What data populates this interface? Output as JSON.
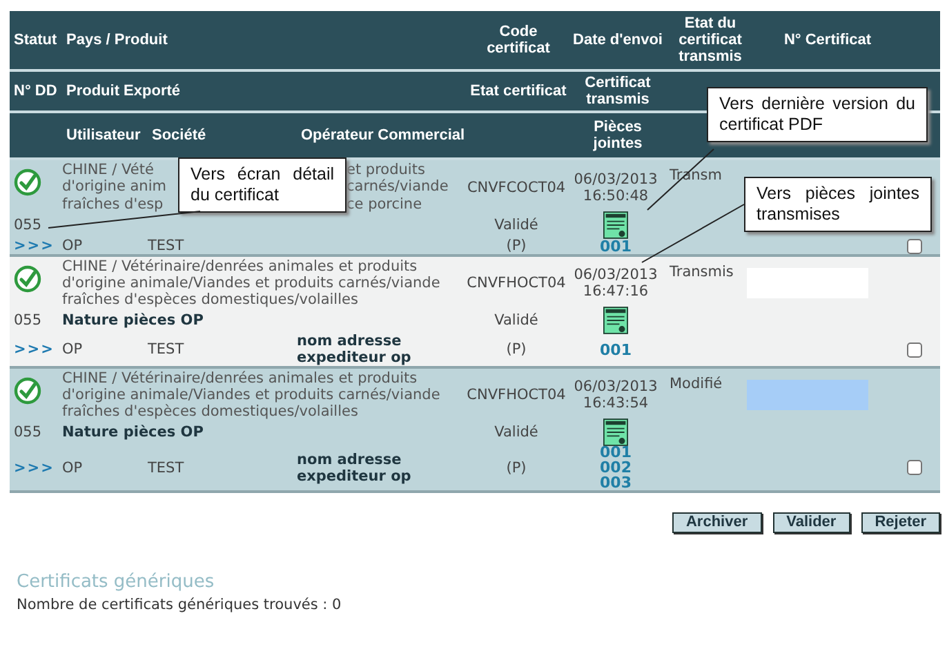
{
  "header": {
    "row_1": {
      "status": "Statut",
      "product": "Pays / Produit",
      "code": "Code certificat",
      "date": "Date d'envoi",
      "state": "Etat du certificat transmis",
      "number": "N° Certificat"
    },
    "row_2": {
      "number": "N° DD",
      "product": "Produit Exporté",
      "state": "Etat certificat",
      "sent": "Certificat transmis"
    },
    "row_3": {
      "user": "Utilisateur",
      "company": "Société",
      "operator": "Opérateur Commercial",
      "attachments": "Pièces jointes"
    }
  },
  "records": [
    {
      "product_fragments": [
        [
          "CHINE / Vété",
          "et produits"
        ],
        [
          "d'origine anim",
          "carnés/viande"
        ],
        [
          "fraîches d'esp",
          "ce porcine"
        ]
      ],
      "code": "CNVFCOCT04",
      "date": "06/03/2013",
      "time": "16:50:48",
      "status": "Transm",
      "number": "055",
      "state": "Validé",
      "user": "OP",
      "company": "TEST",
      "mention": "(P)",
      "attachments": [
        "001"
      ],
      "checked": false,
      "link": ">>>"
    },
    {
      "product": "CHINE / Vétérinaire/denrées animales et produits d'origine animale/Viandes et produits carnés/viande fraîches d'espèces domestiques/volailles",
      "code": "CNVFHOCT04",
      "date": "06/03/2013",
      "time": "16:47:16",
      "status": "Transmis",
      "cert_field": {
        "highlighted": false
      },
      "number": "055",
      "nature": "Nature pièces OP",
      "state": "Validé",
      "user": "OP",
      "company": "TEST",
      "operator": "nom adresse expediteur op",
      "mention": "(P)",
      "attachments": [
        "001"
      ],
      "checked": false,
      "link": ">>>"
    },
    {
      "product": "CHINE / Vétérinaire/denrées animales et produits d'origine animale/Viandes et produits carnés/viande fraîches d'espèces domestiques/volailles",
      "code": "CNVFHOCT04",
      "date": "06/03/2013",
      "time": "16:43:54",
      "status": "Modifié",
      "cert_field": {
        "highlighted": true
      },
      "number": "055",
      "nature": "Nature pièces OP",
      "state": "Validé",
      "user": "OP",
      "company": "TEST",
      "operator": "nom adresse expediteur op",
      "mention": "(P)",
      "attachments": [
        "001",
        "002",
        "003"
      ],
      "checked": false,
      "link": ">>>"
    }
  ],
  "callouts": {
    "detail": "Vers écran détail du certificat",
    "pdf": "Vers dernière version du certificat PDF",
    "attachments": "Vers pièces jointes transmises"
  },
  "buttons": [
    "Archiver",
    "Valider",
    "Rejeter"
  ],
  "generic": {
    "title": "Certificats génériques",
    "count": "Nombre de certificats génériques trouvés : 0"
  }
}
